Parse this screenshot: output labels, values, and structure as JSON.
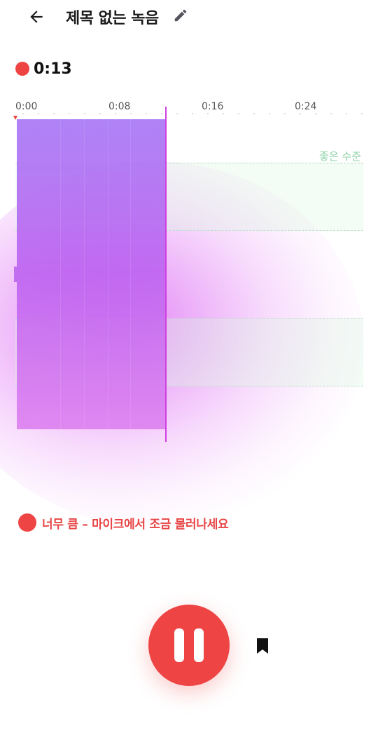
{
  "header": {
    "back_icon": "arrow-left-icon",
    "title": "제목 없는 녹음",
    "edit_icon": "pencil-icon"
  },
  "recorder": {
    "elapsed": "0:13",
    "rec_indicator_color": "#ee4444"
  },
  "timeline": {
    "ticks": [
      "0:00",
      "0:08",
      "0:16",
      "0:24"
    ],
    "good_level_label": "좋은 수준",
    "level_color": "#b060f0",
    "good_band_color": "#b8e0c8"
  },
  "warning": {
    "text": "너무 큼 – 마이크에서 조금 물러나세요",
    "color": "#e84545"
  },
  "controls": {
    "pause_icon": "pause-icon",
    "bookmark_icon": "bookmark-icon",
    "accent": "#ee4444"
  }
}
